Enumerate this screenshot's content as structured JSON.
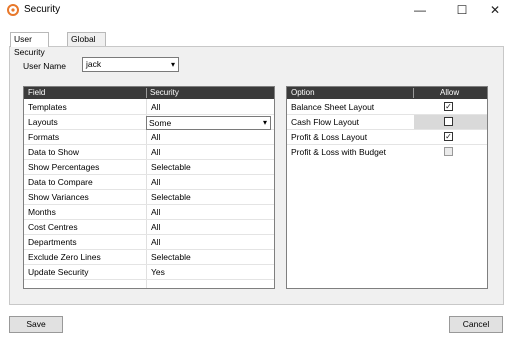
{
  "window": {
    "title": "Security",
    "minimize_glyph": "—",
    "maximize_glyph": "☐",
    "close_glyph": "✕"
  },
  "tabs": [
    {
      "label": "User Security",
      "active": true
    },
    {
      "label": "Global Security",
      "active": false
    }
  ],
  "user": {
    "label": "User Name",
    "value": "jack"
  },
  "field_grid": {
    "headers": {
      "field": "Field",
      "security": "Security"
    },
    "rows": [
      {
        "field": "Templates",
        "security": "All"
      },
      {
        "field": "Layouts",
        "security": "Some"
      },
      {
        "field": "Formats",
        "security": "All"
      },
      {
        "field": "Data to Show",
        "security": "All"
      },
      {
        "field": "Show Percentages",
        "security": "Selectable"
      },
      {
        "field": "Data to Compare",
        "security": "All"
      },
      {
        "field": "Show Variances",
        "security": "Selectable"
      },
      {
        "field": "Months",
        "security": "All"
      },
      {
        "field": "Cost Centres",
        "security": "All"
      },
      {
        "field": "Departments",
        "security": "All"
      },
      {
        "field": "Exclude Zero Lines",
        "security": "Selectable"
      },
      {
        "field": "Update Security",
        "security": "Yes"
      }
    ]
  },
  "option_grid": {
    "headers": {
      "option": "Option",
      "allow": "Allow"
    },
    "rows": [
      {
        "option": "Balance Sheet Layout",
        "checked": true
      },
      {
        "option": "Cash  Flow Layout",
        "checked": false,
        "selected": true
      },
      {
        "option": "Profit & Loss Layout",
        "checked": true
      },
      {
        "option": "Profit & Loss with Budget",
        "checked": false,
        "disabled": true
      }
    ]
  },
  "buttons": {
    "save": "Save",
    "cancel": "Cancel"
  },
  "colors": {
    "accent_icon": "#e8782b",
    "grid_header": "#3a3a3a",
    "selected_row": "#d9d9d9"
  },
  "icons": {
    "app": "gear-icon",
    "check": "✓",
    "dropdown": "▾"
  }
}
